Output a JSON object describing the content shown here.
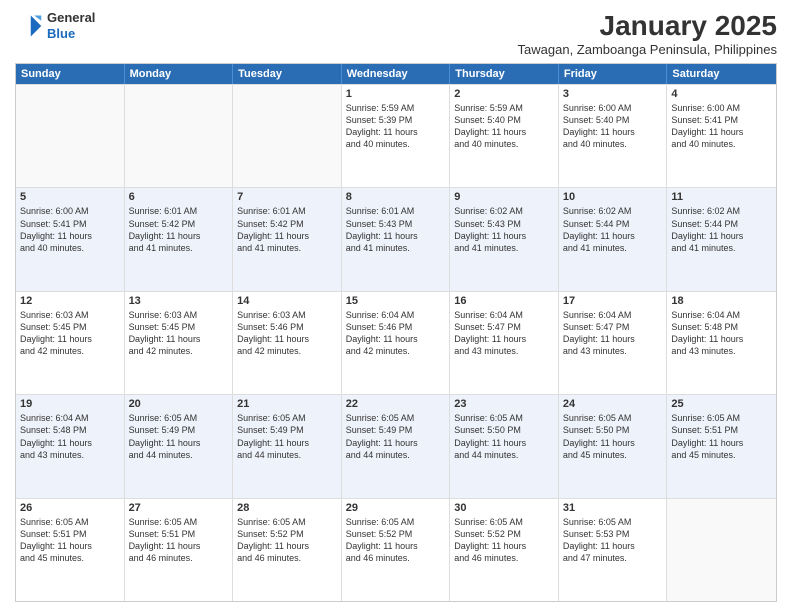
{
  "logo": {
    "general": "General",
    "blue": "Blue"
  },
  "title": "January 2025",
  "subtitle": "Tawagan, Zamboanga Peninsula, Philippines",
  "headers": [
    "Sunday",
    "Monday",
    "Tuesday",
    "Wednesday",
    "Thursday",
    "Friday",
    "Saturday"
  ],
  "weeks": [
    [
      {
        "day": "",
        "lines": []
      },
      {
        "day": "",
        "lines": []
      },
      {
        "day": "",
        "lines": []
      },
      {
        "day": "1",
        "lines": [
          "Sunrise: 5:59 AM",
          "Sunset: 5:39 PM",
          "Daylight: 11 hours",
          "and 40 minutes."
        ]
      },
      {
        "day": "2",
        "lines": [
          "Sunrise: 5:59 AM",
          "Sunset: 5:40 PM",
          "Daylight: 11 hours",
          "and 40 minutes."
        ]
      },
      {
        "day": "3",
        "lines": [
          "Sunrise: 6:00 AM",
          "Sunset: 5:40 PM",
          "Daylight: 11 hours",
          "and 40 minutes."
        ]
      },
      {
        "day": "4",
        "lines": [
          "Sunrise: 6:00 AM",
          "Sunset: 5:41 PM",
          "Daylight: 11 hours",
          "and 40 minutes."
        ]
      }
    ],
    [
      {
        "day": "5",
        "lines": [
          "Sunrise: 6:00 AM",
          "Sunset: 5:41 PM",
          "Daylight: 11 hours",
          "and 40 minutes."
        ]
      },
      {
        "day": "6",
        "lines": [
          "Sunrise: 6:01 AM",
          "Sunset: 5:42 PM",
          "Daylight: 11 hours",
          "and 41 minutes."
        ]
      },
      {
        "day": "7",
        "lines": [
          "Sunrise: 6:01 AM",
          "Sunset: 5:42 PM",
          "Daylight: 11 hours",
          "and 41 minutes."
        ]
      },
      {
        "day": "8",
        "lines": [
          "Sunrise: 6:01 AM",
          "Sunset: 5:43 PM",
          "Daylight: 11 hours",
          "and 41 minutes."
        ]
      },
      {
        "day": "9",
        "lines": [
          "Sunrise: 6:02 AM",
          "Sunset: 5:43 PM",
          "Daylight: 11 hours",
          "and 41 minutes."
        ]
      },
      {
        "day": "10",
        "lines": [
          "Sunrise: 6:02 AM",
          "Sunset: 5:44 PM",
          "Daylight: 11 hours",
          "and 41 minutes."
        ]
      },
      {
        "day": "11",
        "lines": [
          "Sunrise: 6:02 AM",
          "Sunset: 5:44 PM",
          "Daylight: 11 hours",
          "and 41 minutes."
        ]
      }
    ],
    [
      {
        "day": "12",
        "lines": [
          "Sunrise: 6:03 AM",
          "Sunset: 5:45 PM",
          "Daylight: 11 hours",
          "and 42 minutes."
        ]
      },
      {
        "day": "13",
        "lines": [
          "Sunrise: 6:03 AM",
          "Sunset: 5:45 PM",
          "Daylight: 11 hours",
          "and 42 minutes."
        ]
      },
      {
        "day": "14",
        "lines": [
          "Sunrise: 6:03 AM",
          "Sunset: 5:46 PM",
          "Daylight: 11 hours",
          "and 42 minutes."
        ]
      },
      {
        "day": "15",
        "lines": [
          "Sunrise: 6:04 AM",
          "Sunset: 5:46 PM",
          "Daylight: 11 hours",
          "and 42 minutes."
        ]
      },
      {
        "day": "16",
        "lines": [
          "Sunrise: 6:04 AM",
          "Sunset: 5:47 PM",
          "Daylight: 11 hours",
          "and 43 minutes."
        ]
      },
      {
        "day": "17",
        "lines": [
          "Sunrise: 6:04 AM",
          "Sunset: 5:47 PM",
          "Daylight: 11 hours",
          "and 43 minutes."
        ]
      },
      {
        "day": "18",
        "lines": [
          "Sunrise: 6:04 AM",
          "Sunset: 5:48 PM",
          "Daylight: 11 hours",
          "and 43 minutes."
        ]
      }
    ],
    [
      {
        "day": "19",
        "lines": [
          "Sunrise: 6:04 AM",
          "Sunset: 5:48 PM",
          "Daylight: 11 hours",
          "and 43 minutes."
        ]
      },
      {
        "day": "20",
        "lines": [
          "Sunrise: 6:05 AM",
          "Sunset: 5:49 PM",
          "Daylight: 11 hours",
          "and 44 minutes."
        ]
      },
      {
        "day": "21",
        "lines": [
          "Sunrise: 6:05 AM",
          "Sunset: 5:49 PM",
          "Daylight: 11 hours",
          "and 44 minutes."
        ]
      },
      {
        "day": "22",
        "lines": [
          "Sunrise: 6:05 AM",
          "Sunset: 5:49 PM",
          "Daylight: 11 hours",
          "and 44 minutes."
        ]
      },
      {
        "day": "23",
        "lines": [
          "Sunrise: 6:05 AM",
          "Sunset: 5:50 PM",
          "Daylight: 11 hours",
          "and 44 minutes."
        ]
      },
      {
        "day": "24",
        "lines": [
          "Sunrise: 6:05 AM",
          "Sunset: 5:50 PM",
          "Daylight: 11 hours",
          "and 45 minutes."
        ]
      },
      {
        "day": "25",
        "lines": [
          "Sunrise: 6:05 AM",
          "Sunset: 5:51 PM",
          "Daylight: 11 hours",
          "and 45 minutes."
        ]
      }
    ],
    [
      {
        "day": "26",
        "lines": [
          "Sunrise: 6:05 AM",
          "Sunset: 5:51 PM",
          "Daylight: 11 hours",
          "and 45 minutes."
        ]
      },
      {
        "day": "27",
        "lines": [
          "Sunrise: 6:05 AM",
          "Sunset: 5:51 PM",
          "Daylight: 11 hours",
          "and 46 minutes."
        ]
      },
      {
        "day": "28",
        "lines": [
          "Sunrise: 6:05 AM",
          "Sunset: 5:52 PM",
          "Daylight: 11 hours",
          "and 46 minutes."
        ]
      },
      {
        "day": "29",
        "lines": [
          "Sunrise: 6:05 AM",
          "Sunset: 5:52 PM",
          "Daylight: 11 hours",
          "and 46 minutes."
        ]
      },
      {
        "day": "30",
        "lines": [
          "Sunrise: 6:05 AM",
          "Sunset: 5:52 PM",
          "Daylight: 11 hours",
          "and 46 minutes."
        ]
      },
      {
        "day": "31",
        "lines": [
          "Sunrise: 6:05 AM",
          "Sunset: 5:53 PM",
          "Daylight: 11 hours",
          "and 47 minutes."
        ]
      },
      {
        "day": "",
        "lines": []
      }
    ]
  ]
}
